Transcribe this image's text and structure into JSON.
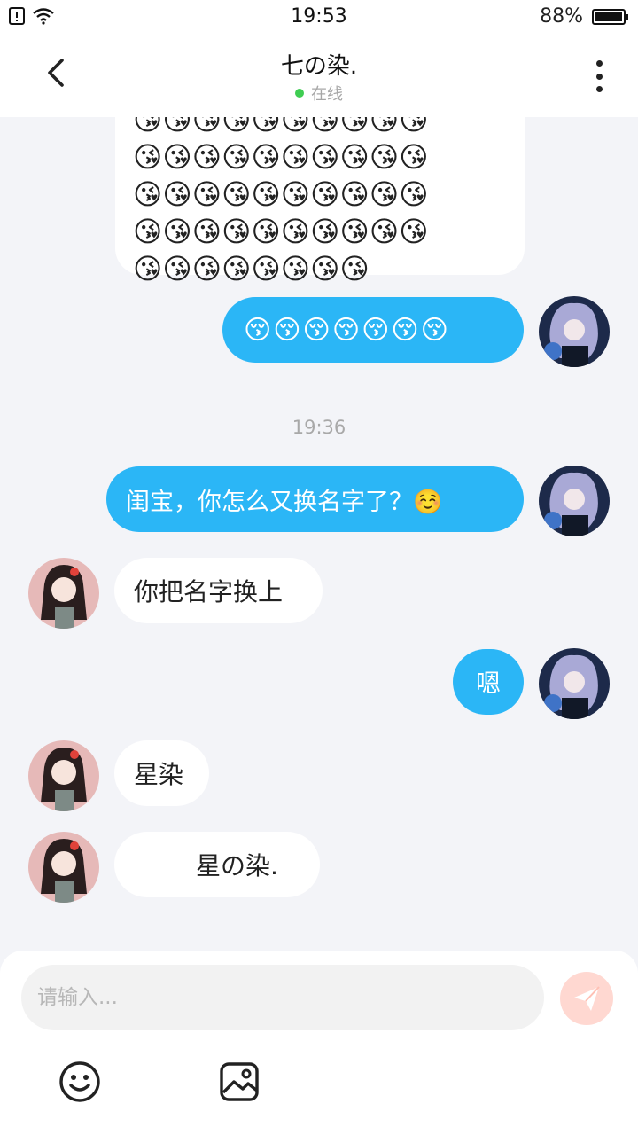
{
  "status_bar": {
    "time": "19:53",
    "battery": "88%",
    "battery_level": 0.88
  },
  "header": {
    "title": "七の染.",
    "status": "在线"
  },
  "chat": {
    "emoji_rows": [
      "😘😘😘😘😘😘😘😘😘😘",
      "😘😘😘😘😘😘😘😘😘😘",
      "😘😘😘😘😘😘😘😘😘😘",
      "😘😘😘😘😘😘😘😘😘😘",
      "😘😘😘😘😘😘😘😘"
    ],
    "msg_out_1": "😚😚😚😚😚😚😚",
    "timestamp": "19:36",
    "msg_out_2": "闺宝，你怎么又换名字了？☺️",
    "msg_in_1": "你把名字换上",
    "msg_out_3": "嗯",
    "msg_in_2": "星染",
    "msg_in_3": "星の染."
  },
  "composer": {
    "placeholder": "请输入..."
  },
  "icons": {
    "back": "chevron-left-icon",
    "more": "more-vertical-icon",
    "send": "send-icon",
    "emoji": "smiley-icon",
    "image": "image-icon"
  },
  "colors": {
    "outgoing_bubble": "#2bb6f6",
    "incoming_bubble": "#ffffff",
    "online_dot": "#3fcd52",
    "send_button": "#ffd8d1"
  }
}
